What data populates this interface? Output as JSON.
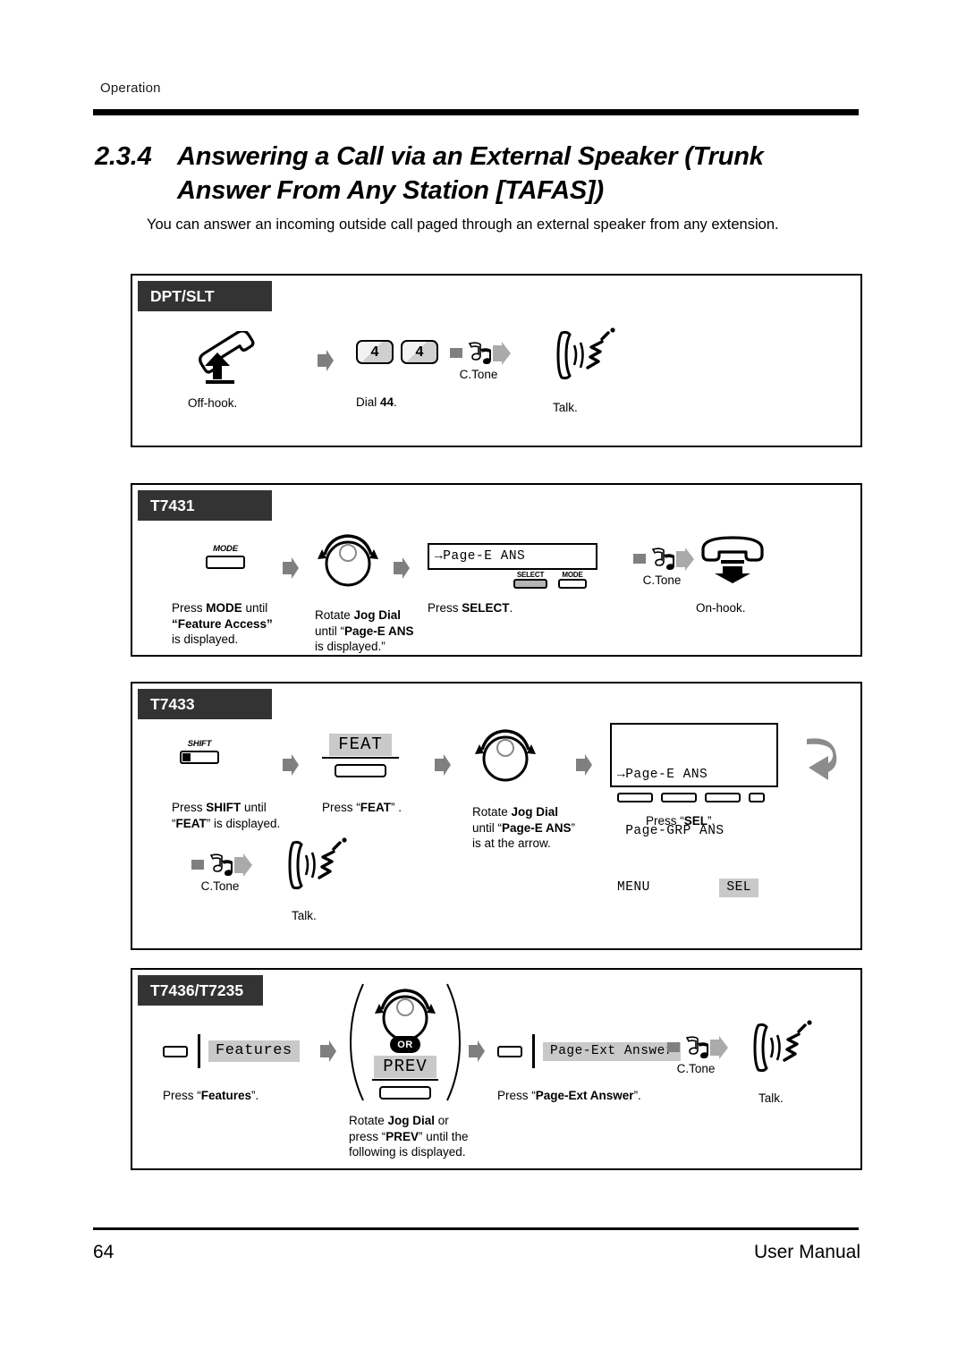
{
  "header": {
    "running_head": "Operation",
    "section_number": "2.3.4",
    "title_line1": "Answering a Call via an External Speaker (Trunk",
    "title_line2": "Answer From Any Station [TAFAS])",
    "intro": "You can answer an incoming outside call paged through an external speaker from any extension."
  },
  "footer": {
    "page_number": "64",
    "manual_label": "User Manual"
  },
  "panels": [
    {
      "tab": "DPT/SLT",
      "steps": {
        "offhook_caption": "Off-hook.",
        "dial_caption_pre": "Dial ",
        "dial_caption_bold": "44",
        "dial_caption_post": ".",
        "key1": "4",
        "key2": "4",
        "ctone": "C.Tone",
        "talk_caption": "Talk."
      }
    },
    {
      "tab": "T7431",
      "steps": {
        "mode_key_label": "MODE",
        "mode_caption_1a": "Press ",
        "mode_caption_1b": "MODE",
        "mode_caption_1c": " until",
        "mode_caption_2": "“Feature Access”",
        "mode_caption_3": "is displayed.",
        "jog_caption_1a": "Rotate ",
        "jog_caption_1b": "Jog Dial",
        "jog_caption_2a": "until “",
        "jog_caption_2b": "Page-E ANS",
        "jog_caption_3": "is displayed.”",
        "lcd_text": "→Page-E ANS",
        "softkey_select": "SELECT",
        "softkey_mode": "MODE",
        "select_caption_a": "Press ",
        "select_caption_b": "SELECT",
        "select_caption_c": ".",
        "ctone": "C.Tone",
        "onhook_caption": "On-hook."
      }
    },
    {
      "tab": "T7433",
      "steps": {
        "shift_key_label": "SHIFT",
        "shift_caption_1a": "Press ",
        "shift_caption_1b": "SHIFT",
        "shift_caption_1c": " until",
        "shift_caption_2a": "“",
        "shift_caption_2b": "FEAT",
        "shift_caption_2c": "” is displayed.",
        "feat_button": "FEAT",
        "feat_caption_a": "Press “",
        "feat_caption_b": "FEAT",
        "feat_caption_c": "” .",
        "jog_caption_1a": "Rotate ",
        "jog_caption_1b": "Jog Dial",
        "jog_caption_2a": "until “",
        "jog_caption_2b": "Page-E ANS",
        "jog_caption_2c": "”",
        "jog_caption_3": "is at the arrow.",
        "lcd_line1": "→Page-E ANS",
        "lcd_line2": " Page-GRP ANS",
        "lcd_line3_left": "MENU",
        "lcd_line3_right": "SEL",
        "sel_caption_a": "Press “",
        "sel_caption_b": "SEL",
        "sel_caption_c": "”.",
        "ctone": "C.Tone",
        "talk_caption": "Talk."
      }
    },
    {
      "tab": "T7436/T7235",
      "steps": {
        "features_label": "Features",
        "features_caption_a": "Press “",
        "features_caption_b": "Features",
        "features_caption_c": "”.",
        "or_badge": "OR",
        "prev_button": "PREV",
        "jog_caption_1a": "Rotate ",
        "jog_caption_1b": "Jog Dial",
        "jog_caption_1c": " or",
        "jog_caption_2a": "press “",
        "jog_caption_2b": "PREV",
        "jog_caption_2c": "” until the",
        "jog_caption_3": "following is displayed.",
        "page_ext_label": "Page-Ext Answer",
        "page_ext_caption_a": "Press “",
        "page_ext_caption_b": "Page-Ext Answer",
        "page_ext_caption_c": "”.",
        "ctone": "C.Tone",
        "talk_caption": "Talk."
      }
    }
  ],
  "icons": {
    "offhook": "offhook-handset-icon",
    "onhook": "onhook-handset-icon",
    "talk": "talk-handset-icon",
    "tone": "confirmation-tone-icon",
    "jog_dial": "jog-dial-icon",
    "arrow": "flow-arrow-icon",
    "wrap": "wrap-arrow-icon"
  },
  "colors": {
    "tab_bg": "#333333",
    "highlight": "#c9c9c9",
    "arrow_gray": "#808080",
    "rule": "#000000"
  }
}
